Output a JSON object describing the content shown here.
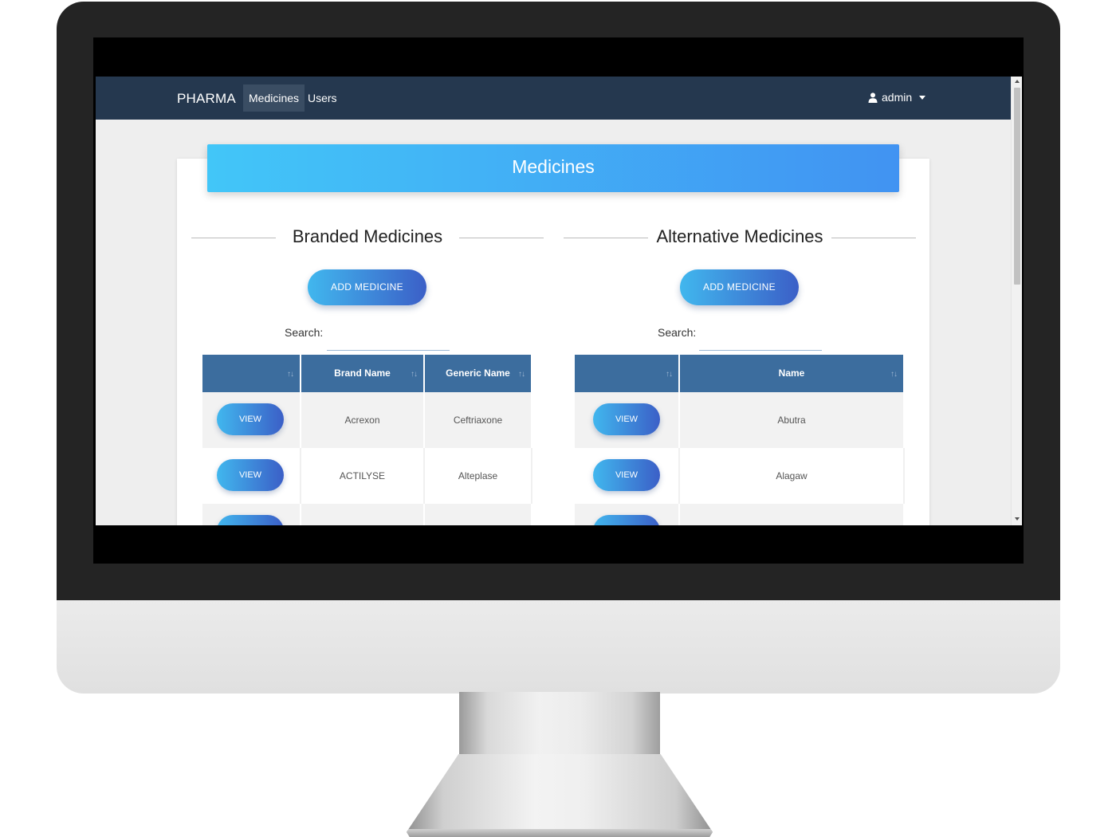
{
  "navbar": {
    "brand": "PHARMA",
    "links": [
      {
        "label": "Medicines",
        "active": true
      },
      {
        "label": "Users",
        "active": false
      }
    ],
    "user": "admin",
    "user_icon": "user-icon",
    "background": "#25384f"
  },
  "page": {
    "title": "Medicines"
  },
  "branded": {
    "title": "Branded Medicines",
    "add_button": "ADD MEDICINE",
    "search_label": "Search:",
    "search_value": "",
    "columns": [
      "",
      "Brand Name",
      "Generic Name"
    ],
    "rows": [
      {
        "action": "VIEW",
        "brand_name": "Acrexon",
        "generic_name": "Ceftriaxone"
      },
      {
        "action": "VIEW",
        "brand_name": "ACTILYSE",
        "generic_name": "Alteplase"
      }
    ]
  },
  "alternative": {
    "title": "Alternative Medicines",
    "add_button": "ADD MEDICINE",
    "search_label": "Search:",
    "search_value": "",
    "columns": [
      "",
      "Name"
    ],
    "rows": [
      {
        "action": "VIEW",
        "name": "Abutra"
      },
      {
        "action": "VIEW",
        "name": "Alagaw"
      }
    ]
  },
  "colors": {
    "header_gradient_start": "#42c6f8",
    "header_gradient_end": "#4193f2",
    "table_header": "#3c6d9e",
    "button_gradient_start": "#41b7ee",
    "button_gradient_end": "#3b5fc7"
  },
  "icons": {
    "sort": "sort-icon",
    "caret": "caret-down-icon"
  }
}
